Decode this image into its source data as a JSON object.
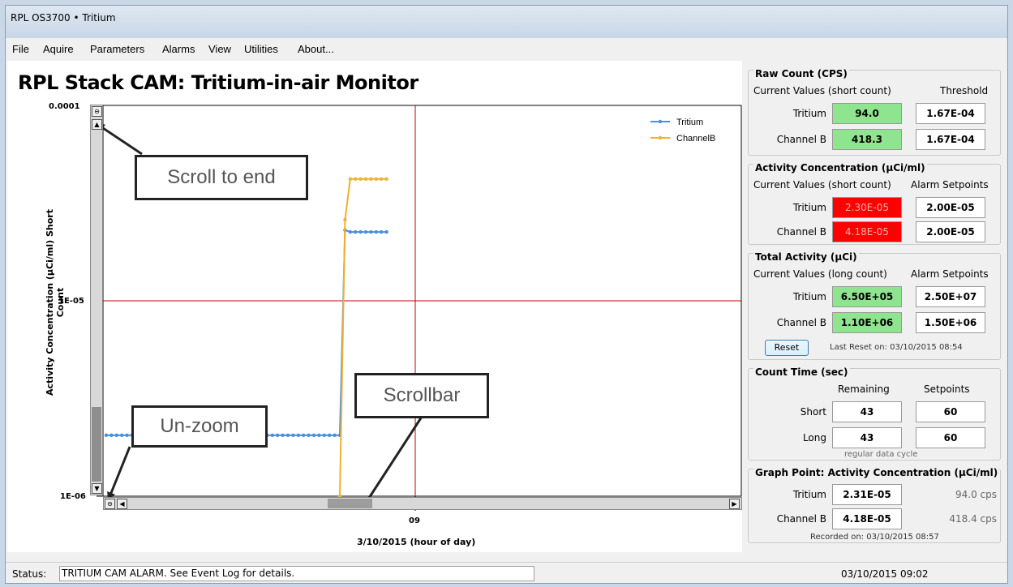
{
  "window": {
    "title": "RPL OS3700 • Tritium"
  },
  "menu": [
    "File",
    "Aquire",
    "Parameters",
    "Alarms",
    "View",
    "Utilities",
    "About..."
  ],
  "page_title": "RPL Stack CAM: Tritium-in-air Monitor",
  "chart_data": {
    "type": "line",
    "ylabel": "Activity Concentration (µCi/ml) Short Count",
    "xlabel": "3/10/2015 (hour of day)",
    "yscale": "log",
    "ylim": [
      1e-06,
      0.0001
    ],
    "y_tick_labels": [
      "0.0001",
      "1E-05",
      "1E-06"
    ],
    "x_tick_labels": [
      "09"
    ],
    "legend": [
      "Tritium",
      "ChannelB"
    ],
    "legend_position": "top-right",
    "series": [
      {
        "name": "Tritium",
        "color": "#4a8fe0",
        "values": [
          2.05e-06,
          2.05e-06,
          2.05e-06,
          2.05e-06,
          2.05e-06,
          2.05e-06,
          2.05e-06,
          2.05e-06,
          2.05e-06,
          2.05e-06,
          2.05e-06,
          2.05e-06,
          2.05e-06,
          2.05e-06,
          2.05e-06,
          2.05e-06,
          2.05e-06,
          2.05e-06,
          2.05e-06,
          2.05e-06,
          2.05e-06,
          2.05e-06,
          2.05e-06,
          2.05e-06,
          2.05e-06,
          2.05e-06,
          2.05e-06,
          2.05e-06,
          2.05e-06,
          2.05e-06,
          2.05e-06,
          2.05e-06,
          2.05e-06,
          2.05e-06,
          2.05e-06,
          2.05e-06,
          2.05e-06,
          2.05e-06,
          2.05e-06,
          2.05e-06,
          2.05e-06,
          2.05e-06,
          2.05e-06,
          2.05e-06,
          2.05e-06,
          2.05e-06,
          2.3e-05,
          2.25e-05,
          2.25e-05,
          2.25e-05,
          2.25e-05,
          2.25e-05,
          2.25e-05,
          2.25e-05,
          2.25e-05
        ]
      },
      {
        "name": "ChannelB",
        "color": "#f0b030",
        "values": [
          null,
          null,
          null,
          null,
          null,
          null,
          null,
          null,
          null,
          null,
          null,
          null,
          null,
          null,
          null,
          null,
          null,
          null,
          null,
          null,
          null,
          null,
          null,
          null,
          null,
          null,
          null,
          null,
          null,
          null,
          null,
          null,
          null,
          null,
          null,
          null,
          null,
          null,
          null,
          null,
          null,
          null,
          null,
          null,
          null,
          1e-06,
          2.6e-05,
          4.2e-05,
          4.2e-05,
          4.2e-05,
          4.2e-05,
          4.2e-05,
          4.2e-05,
          4.2e-05,
          4.2e-05
        ]
      }
    ],
    "alarm_line_y": 1e-05
  },
  "callouts": {
    "scroll_to_end": "Scroll to end",
    "unzoom": "Un-zoom",
    "scrollbar": "Scrollbar"
  },
  "raw_count": {
    "title": "Raw Count (CPS)",
    "col1": "Current Values (short count)",
    "col2": "Threshold",
    "rows": [
      {
        "label": "Tritium",
        "value": "94.0",
        "threshold": "1.67E-04"
      },
      {
        "label": "Channel B",
        "value": "418.3",
        "threshold": "1.67E-04"
      }
    ]
  },
  "activity": {
    "title": "Activity Concentration (µCi/ml)",
    "col1": "Current Values (short count)",
    "col2": "Alarm Setpoints",
    "rows": [
      {
        "label": "Tritium",
        "value": "2.30E-05",
        "setpoint": "2.00E-05"
      },
      {
        "label": "Channel B",
        "value": "4.18E-05",
        "setpoint": "2.00E-05"
      }
    ]
  },
  "total": {
    "title": "Total Activity (µCi)",
    "col1": "Current Values (long count)",
    "col2": "Alarm Setpoints",
    "rows": [
      {
        "label": "Tritium",
        "value": "6.50E+05",
        "setpoint": "2.50E+07"
      },
      {
        "label": "Channel B",
        "value": "1.10E+06",
        "setpoint": "1.50E+06"
      }
    ],
    "reset_label": "Reset",
    "last_reset": "Last Reset on: 03/10/2015 08:54"
  },
  "count_time": {
    "title": "Count Time (sec)",
    "col1": "Remaining",
    "col2": "Setpoints",
    "rows": [
      {
        "label": "Short",
        "remaining": "43",
        "setpoint": "60"
      },
      {
        "label": "Long",
        "remaining": "43",
        "setpoint": "60"
      }
    ],
    "note": "regular data cycle"
  },
  "graph_point": {
    "title": "Graph Point: Activity Concentration (µCi/ml)",
    "rows": [
      {
        "label": "Tritium",
        "value": "2.31E-05",
        "cps": "94.0 cps"
      },
      {
        "label": "Channel B",
        "value": "4.18E-05",
        "cps": "418.4 cps"
      }
    ],
    "recorded": "Recorded on: 03/10/2015 08:57"
  },
  "status": {
    "label": "Status:",
    "text": "TRITIUM CAM ALARM. See Event Log for details.",
    "datetime": "03/10/2015 09:02"
  },
  "colors": {
    "alarm": "#ff0000",
    "ok": "#8fe48f",
    "redline": "#c00000"
  }
}
